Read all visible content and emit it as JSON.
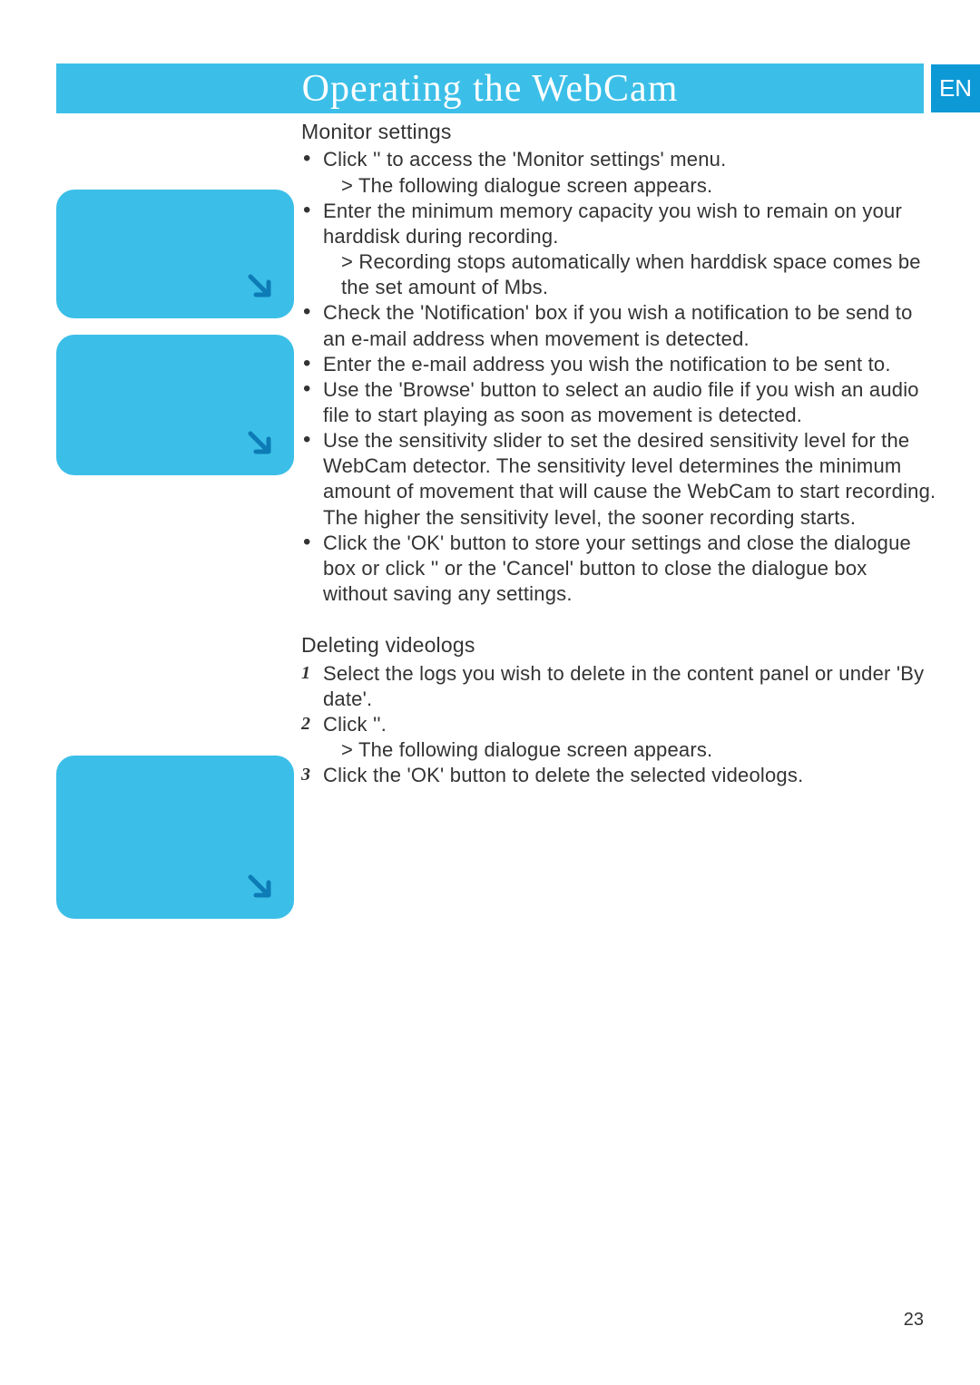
{
  "header": {
    "title": "Operating the WebCam",
    "lang_badge": "EN"
  },
  "section1": {
    "heading": "Monitor settings",
    "bullets": [
      {
        "pre": "Click '",
        "post": "' to access the 'Monitor settings' menu.",
        "sub": "> The following dialogue screen appears."
      },
      {
        "text": "Enter the minimum memory capacity you wish to remain on your harddisk during recording.",
        "sub": "> Recording stops automatically when harddisk space comes be the set amount of Mbs."
      },
      {
        "text": "Check the 'Notification' box if you wish a notification to be send to an e-mail address when movement is detected."
      },
      {
        "text": "Enter the e-mail address you wish the notification to be sent to."
      },
      {
        "text": "Use the 'Browse' button to select an audio file if you wish an audio file to start playing as soon as movement is detected."
      },
      {
        "text": "Use the sensitivity slider to set the desired sensitivity level for the WebCam detector. The sensitivity level determines the minimum amount of movement that will cause the WebCam to start recording.",
        "trail": "The higher the sensitivity level, the sooner recording starts."
      },
      {
        "text": "Click the 'OK' button to store your settings and close the dialogue box or click '",
        "mid": "' or the 'Cancel' button to close the dialogue box without saving any settings."
      }
    ]
  },
  "section2": {
    "heading": "Deleting videologs",
    "steps": [
      {
        "num": "1",
        "text": "Select the logs you wish to delete in the content panel or under 'By date'."
      },
      {
        "num": "2",
        "pre": "Click '",
        "post": "'.",
        "sub": "> The following dialogue screen appears."
      },
      {
        "num": "3",
        "text": "Click the 'OK' button to delete the selected videologs."
      }
    ]
  },
  "page_number": "23"
}
